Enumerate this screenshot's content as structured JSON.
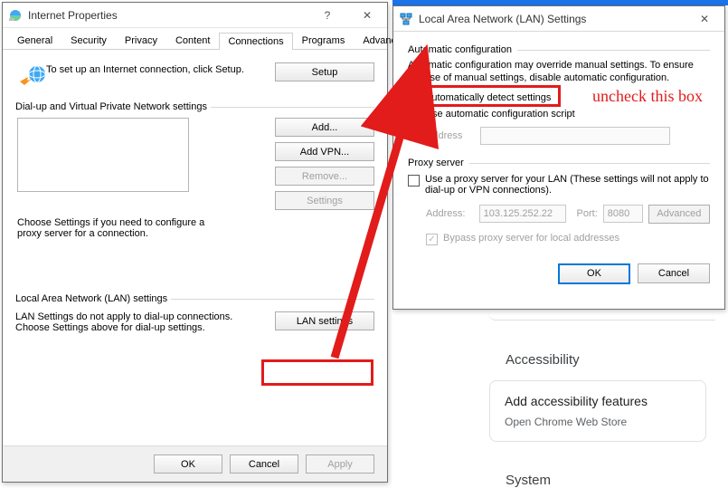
{
  "ip_window": {
    "title": "Internet Properties",
    "tabs": [
      "General",
      "Security",
      "Privacy",
      "Content",
      "Connections",
      "Programs",
      "Advanced"
    ],
    "active_tab": "Connections",
    "setup_text": "To set up an Internet connection, click Setup.",
    "setup_btn": "Setup",
    "dialup_group": "Dial-up and Virtual Private Network settings",
    "add_btn": "Add...",
    "addvpn_btn": "Add VPN...",
    "remove_btn": "Remove...",
    "settings_btn": "Settings",
    "dialup_note": "Choose Settings if you need to configure a proxy server for a connection.",
    "lan_group": "Local Area Network (LAN) settings",
    "lan_note": "LAN Settings do not apply to dial-up connections. Choose Settings above for dial-up settings.",
    "lan_btn": "LAN settings",
    "ok": "OK",
    "cancel": "Cancel",
    "apply": "Apply"
  },
  "lan_window": {
    "title": "Local Area Network (LAN) Settings",
    "auto_group": "Automatic configuration",
    "auto_desc": "Automatic configuration may override manual settings.  To ensure the use of manual settings, disable automatic configuration.",
    "auto_detect": "Automatically detect settings",
    "use_script": "Use automatic configuration script",
    "address_lbl": "Address",
    "proxy_group": "Proxy server",
    "proxy_desc": "Use a proxy server for your LAN (These settings will not apply to dial-up or VPN connections).",
    "addr_lbl": "Address:",
    "addr_val": "103.125.252.22",
    "port_lbl": "Port:",
    "port_val": "8080",
    "advanced_btn": "Advanced",
    "bypass": "Bypass proxy server for local addresses",
    "ok": "OK",
    "cancel": "Cancel"
  },
  "annotation": {
    "text": "uncheck this box"
  },
  "chrome": {
    "accessibility": "Accessibility",
    "card_title": "Add accessibility features",
    "card_link": "Open Chrome Web Store",
    "system": "System"
  }
}
